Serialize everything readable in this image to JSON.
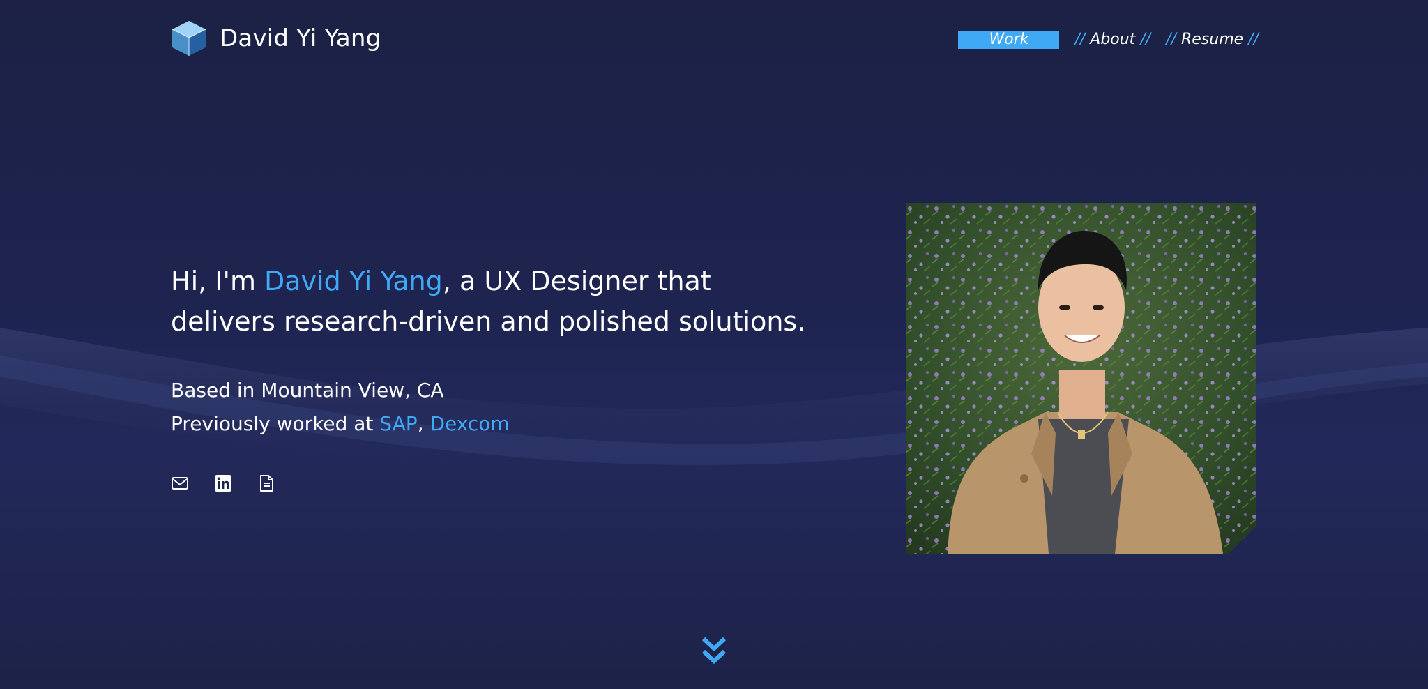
{
  "brand": {
    "name": "David Yi Yang",
    "logo_icon": "cube-icon"
  },
  "nav": {
    "items": [
      {
        "label": "Work",
        "active": true
      },
      {
        "label": "About",
        "active": false
      },
      {
        "label": "Resume",
        "active": false
      }
    ],
    "slash": "//"
  },
  "hero": {
    "intro": "Hi, I'm ",
    "name": "David Yi Yang",
    "tagline_line1": ", a UX Designer that",
    "tagline_line2": "delivers research-driven and polished solutions.",
    "location": "Based in Mountain View, CA",
    "previous_prefix": "Previously worked at ",
    "companies": [
      "SAP",
      "Dexcom"
    ],
    "separator": ", "
  },
  "socials": [
    {
      "icon": "email-icon"
    },
    {
      "icon": "linkedin-icon"
    },
    {
      "icon": "document-icon"
    }
  ],
  "portrait": {
    "icon": "portrait-photo"
  },
  "scroll": {
    "icon": "chevron-double-down-icon"
  },
  "colors": {
    "accent": "#3fa9f5",
    "background": "#1e2347",
    "text": "#ffffff"
  }
}
